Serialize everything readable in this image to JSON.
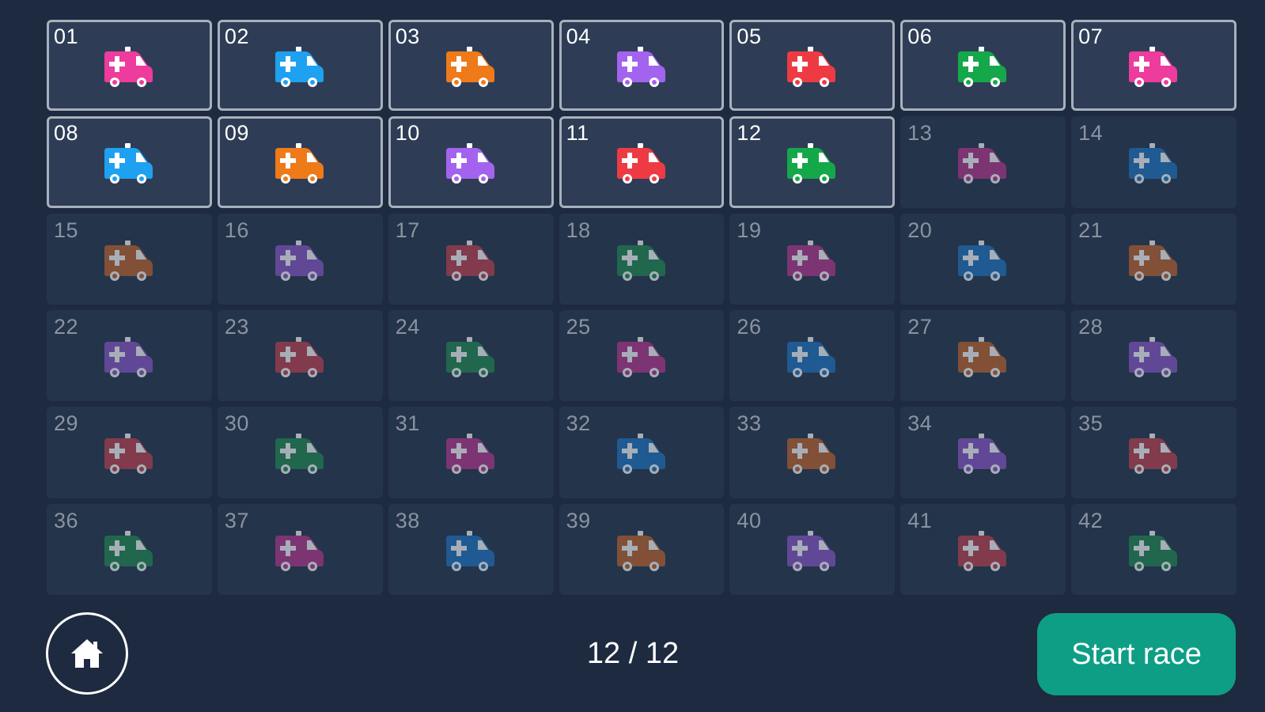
{
  "slots": [
    {
      "label": "01",
      "color": "#ee3b9e",
      "selected": true
    },
    {
      "label": "02",
      "color": "#1ea1f0",
      "selected": true
    },
    {
      "label": "03",
      "color": "#ee7a1a",
      "selected": true
    },
    {
      "label": "04",
      "color": "#a463ee",
      "selected": true
    },
    {
      "label": "05",
      "color": "#ee3b43",
      "selected": true
    },
    {
      "label": "06",
      "color": "#14a84a",
      "selected": true
    },
    {
      "label": "07",
      "color": "#ee3b9e",
      "selected": true
    },
    {
      "label": "08",
      "color": "#1ea1f0",
      "selected": true
    },
    {
      "label": "09",
      "color": "#ee7a1a",
      "selected": true
    },
    {
      "label": "10",
      "color": "#a463ee",
      "selected": true
    },
    {
      "label": "11",
      "color": "#ee3b43",
      "selected": true
    },
    {
      "label": "12",
      "color": "#14a84a",
      "selected": true
    },
    {
      "label": "13",
      "color": "#b9348f",
      "selected": false
    },
    {
      "label": "14",
      "color": "#1c74c2",
      "selected": false
    },
    {
      "label": "15",
      "color": "#c0642b",
      "selected": false
    },
    {
      "label": "16",
      "color": "#8a56c8",
      "selected": false
    },
    {
      "label": "17",
      "color": "#c0404e",
      "selected": false
    },
    {
      "label": "18",
      "color": "#1e8a4f",
      "selected": false
    },
    {
      "label": "19",
      "color": "#b9348f",
      "selected": false
    },
    {
      "label": "20",
      "color": "#1c74c2",
      "selected": false
    },
    {
      "label": "21",
      "color": "#c0642b",
      "selected": false
    },
    {
      "label": "22",
      "color": "#8a56c8",
      "selected": false
    },
    {
      "label": "23",
      "color": "#c0404e",
      "selected": false
    },
    {
      "label": "24",
      "color": "#1e8a4f",
      "selected": false
    },
    {
      "label": "25",
      "color": "#b9348f",
      "selected": false
    },
    {
      "label": "26",
      "color": "#1c74c2",
      "selected": false
    },
    {
      "label": "27",
      "color": "#c0642b",
      "selected": false
    },
    {
      "label": "28",
      "color": "#8a56c8",
      "selected": false
    },
    {
      "label": "29",
      "color": "#c0404e",
      "selected": false
    },
    {
      "label": "30",
      "color": "#1e8a4f",
      "selected": false
    },
    {
      "label": "31",
      "color": "#b9348f",
      "selected": false
    },
    {
      "label": "32",
      "color": "#1c74c2",
      "selected": false
    },
    {
      "label": "33",
      "color": "#c0642b",
      "selected": false
    },
    {
      "label": "34",
      "color": "#8a56c8",
      "selected": false
    },
    {
      "label": "35",
      "color": "#c0404e",
      "selected": false
    },
    {
      "label": "36",
      "color": "#1e8a4f",
      "selected": false
    },
    {
      "label": "37",
      "color": "#b9348f",
      "selected": false
    },
    {
      "label": "38",
      "color": "#1c74c2",
      "selected": false
    },
    {
      "label": "39",
      "color": "#c0642b",
      "selected": false
    },
    {
      "label": "40",
      "color": "#8a56c8",
      "selected": false
    },
    {
      "label": "41",
      "color": "#c0404e",
      "selected": false
    },
    {
      "label": "42",
      "color": "#1e8a4f",
      "selected": false
    }
  ],
  "footer": {
    "home_icon": "home-icon",
    "counter": "12 / 12",
    "start_label": "Start race"
  },
  "colors": {
    "background": "#1e2a3f",
    "cell": "#24344b",
    "cell_selected": "#2e3d55",
    "accent": "#0e9e86"
  }
}
